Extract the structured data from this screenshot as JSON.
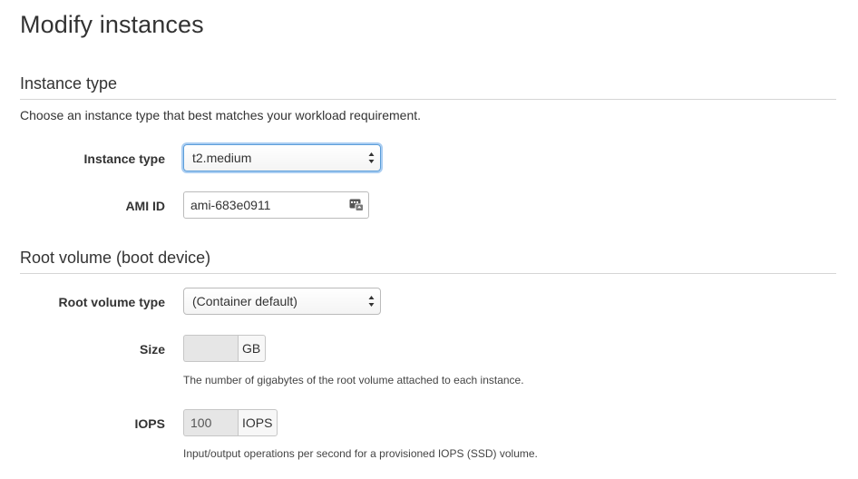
{
  "page": {
    "title": "Modify instances"
  },
  "instance_section": {
    "title": "Instance type",
    "description": "Choose an instance type that best matches your workload requirement.",
    "instance_type": {
      "label": "Instance type",
      "value": "t2.medium"
    },
    "ami_id": {
      "label": "AMI ID",
      "value": "ami-683e0911"
    }
  },
  "root_section": {
    "title": "Root volume (boot device)",
    "root_volume_type": {
      "label": "Root volume type",
      "value": "(Container default)"
    },
    "size": {
      "label": "Size",
      "value": "",
      "unit": "GB",
      "help": "The number of gigabytes of the root volume attached to each instance."
    },
    "iops": {
      "label": "IOPS",
      "value": "100",
      "unit": "IOPS",
      "help": "Input/output operations per second for a provisioned IOPS (SSD) volume."
    }
  },
  "colors": {
    "focus_border": "#5b9dd9",
    "focus_glow": "#a9cdf2",
    "disabled_input": "#e6e6e6"
  },
  "icons": {
    "select": "select-arrows-icon",
    "credential": "keychain-icon"
  }
}
